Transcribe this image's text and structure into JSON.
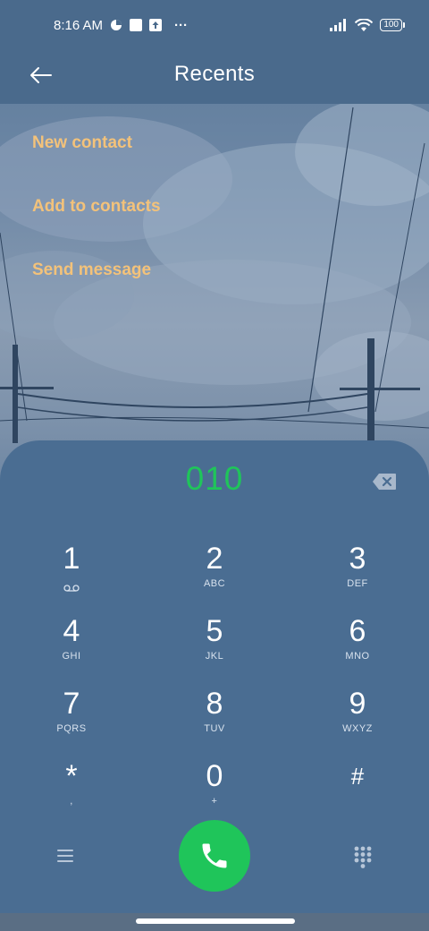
{
  "status_bar": {
    "time": "8:16 AM",
    "more": "···",
    "battery": "100"
  },
  "header": {
    "title": "Recents",
    "back_icon": "arrow-left-icon"
  },
  "options": [
    {
      "label": "New contact"
    },
    {
      "label": "Add to contacts"
    },
    {
      "label": "Send message"
    }
  ],
  "dialer": {
    "number": "010",
    "keys": [
      {
        "digit": "1",
        "letters": ""
      },
      {
        "digit": "2",
        "letters": "ABC"
      },
      {
        "digit": "3",
        "letters": "DEF"
      },
      {
        "digit": "4",
        "letters": "GHI"
      },
      {
        "digit": "5",
        "letters": "JKL"
      },
      {
        "digit": "6",
        "letters": "MNO"
      },
      {
        "digit": "7",
        "letters": "PQRS"
      },
      {
        "digit": "8",
        "letters": "TUV"
      },
      {
        "digit": "9",
        "letters": "WXYZ"
      },
      {
        "digit": "*",
        "letters": ","
      },
      {
        "digit": "0",
        "letters": "+"
      },
      {
        "digit": "#",
        "letters": ""
      }
    ]
  },
  "colors": {
    "accent_option": "#f3c27a",
    "number_green": "#1fc55a",
    "call_button": "#1fc55a",
    "panel": "#4a6d92"
  }
}
